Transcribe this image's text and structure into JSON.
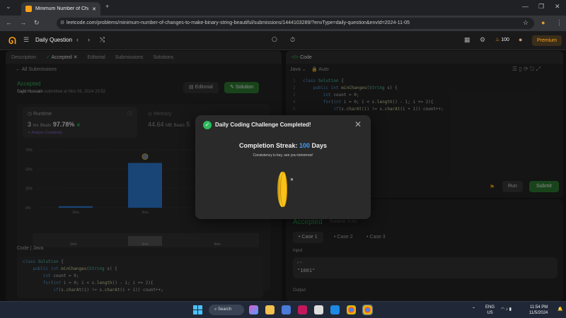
{
  "browser": {
    "tab_title": "Minimum Number of Changes",
    "url": "leetcode.com/problems/minimum-number-of-changes-to-make-binary-string-beautiful/submissions/1444103289/?envType=daily-question&envId=2024-11-05"
  },
  "topbar": {
    "daily_question": "Daily Question",
    "streak_count": "100",
    "premium": "Premium"
  },
  "left_panel": {
    "tabs": [
      "Description",
      "Accepted",
      "Editorial",
      "Submissions",
      "Solutions"
    ],
    "breadcrumb": "All Submissions",
    "status": "Accepted",
    "author": "Sajid Hussain",
    "submitted": "submitted at Nov 05, 2024 23:52",
    "editorial_btn": "Editorial",
    "solution_btn": "Solution",
    "runtime_label": "Runtime",
    "runtime_value": "3",
    "runtime_unit": "ms",
    "beats_label": "Beats",
    "runtime_beats": "97.78%",
    "analyze": "Analyze Complexity",
    "memory_label": "Memory",
    "memory_value": "44.64",
    "memory_unit": "MB",
    "memory_beats_partial": "5",
    "code_header": "Code",
    "code_lang": "Java",
    "code_lines": [
      "class Solution {",
      "    public int minChanges(String s) {",
      "        int count = 0;",
      "        for(int i = 0; i < s.length() - 1; i += 2){",
      "            if(s.charAt(i) != s.charAt(i + 1)) count++;"
    ]
  },
  "chart_data": {
    "type": "bar",
    "categories": [
      "2ms",
      "3ms",
      "4ms"
    ],
    "values": [
      2,
      58,
      0
    ],
    "yticks": [
      "75%",
      "50%",
      "25%",
      "0%"
    ],
    "ylim": [
      0,
      75
    ],
    "highlight_category": "3ms",
    "bar_color": "#2f7fd8"
  },
  "right_panel": {
    "tab": "Code",
    "lang": "Java",
    "auto": "Auto",
    "code_lines": [
      "class Solution {",
      "    public int minChanges(String s) {",
      "        int count = 0;",
      "        for(int i = 0; i < s.length() - 1; i += 2){",
      "            if(s.charAt(i) != s.charAt(i + 1)) count++;"
    ],
    "line_numbers": [
      "1",
      "2",
      "3",
      "4",
      "5"
    ],
    "run_btn": "Run",
    "submit_btn": "Submit"
  },
  "result_panel": {
    "status": "Accepted",
    "runtime": "Runtime: 0 ms",
    "cases": [
      "Case 1",
      "Case 2",
      "Case 3"
    ],
    "input_label": "Input",
    "var_name": "s =",
    "input_value": "\"1001\"",
    "output_label": "Output"
  },
  "modal": {
    "title": "Daily Coding Challenge Completed!",
    "streak_label": "Completion Streak:",
    "streak_num": "100",
    "streak_unit": "Days",
    "message": "Consistency is key, see you tomorrow!"
  },
  "taskbar": {
    "search": "Search",
    "lang_top": "ENG",
    "lang_bottom": "US",
    "time": "11:54 PM",
    "date": "11/5/2024"
  },
  "colors": {
    "accent": "#ffa116",
    "green": "#2cbb5d",
    "blue": "#3b9cff"
  }
}
